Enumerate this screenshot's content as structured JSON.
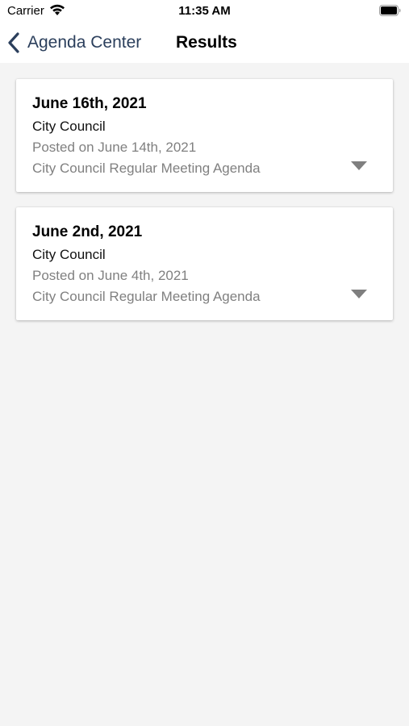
{
  "status_bar": {
    "carrier": "Carrier",
    "time": "11:35 AM",
    "wifi_icon": "wifi-icon",
    "battery_icon": "battery-icon"
  },
  "nav": {
    "back_label": "Agenda Center",
    "back_icon": "chevron-left-icon",
    "title": "Results",
    "accent_color": "#2b3f5c"
  },
  "results": [
    {
      "date": "June 16th, 2021",
      "category": "City Council",
      "posted": "Posted on June 14th, 2021",
      "description": "City Council Regular Meeting Agenda",
      "expand_icon": "triangle-down-icon"
    },
    {
      "date": "June 2nd, 2021",
      "category": "City Council",
      "posted": "Posted on June 4th, 2021",
      "description": "City Council Regular Meeting Agenda",
      "expand_icon": "triangle-down-icon"
    }
  ],
  "colors": {
    "background": "#f4f4f4",
    "card": "#ffffff",
    "secondary_text": "#808080"
  }
}
